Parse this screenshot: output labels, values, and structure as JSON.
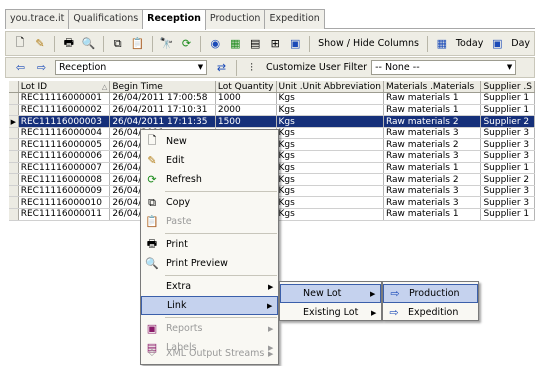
{
  "tabs": [
    {
      "label": "you.trace.it",
      "active": false
    },
    {
      "label": "Qualifications",
      "active": false
    },
    {
      "label": "Reception",
      "active": true
    },
    {
      "label": "Production",
      "active": false
    },
    {
      "label": "Expedition",
      "active": false
    }
  ],
  "toolbar1": {
    "show_hide_columns": "Show / Hide Columns",
    "today": "Today",
    "day": "Day"
  },
  "toolbar2": {
    "view_select": "Reception",
    "customize_filter": "Customize User Filter",
    "filter_select": "-- None --"
  },
  "grid": {
    "columns": [
      "Lot ID",
      "Begin Time",
      "Lot Quantity",
      "Unit .Unit Abbreviation",
      "Materials .Materials",
      "Supplier .S"
    ],
    "rows": [
      [
        "REC11116000001",
        "26/04/2011 17:00:58",
        "1000",
        "Kgs",
        "Raw materials 1",
        "Supplier 1"
      ],
      [
        "REC11116000002",
        "26/04/2011 17:10:31",
        "2000",
        "Kgs",
        "Raw materials 1",
        "Supplier 1"
      ],
      [
        "REC11116000003",
        "26/04/2011 17:11:35",
        "1500",
        "Kgs",
        "Raw materials 2",
        "Supplier 2"
      ],
      [
        "REC11116000004",
        "26/04/2011",
        "",
        "Kgs",
        "Raw materials 3",
        "Supplier 3"
      ],
      [
        "REC11116000005",
        "26/04/2011",
        "",
        "Kgs",
        "Raw materials 2",
        "Supplier 3"
      ],
      [
        "REC11116000006",
        "26/04/2011",
        "",
        "Kgs",
        "Raw materials 3",
        "Supplier 3"
      ],
      [
        "REC11116000007",
        "26/04/2011",
        "",
        "Kgs",
        "Raw materials 1",
        "Supplier 1"
      ],
      [
        "REC11116000008",
        "26/04/2011",
        "",
        "Kgs",
        "Raw materials 2",
        "Supplier 2"
      ],
      [
        "REC11116000009",
        "26/04/2011",
        "",
        "Kgs",
        "Raw materials 3",
        "Supplier 3"
      ],
      [
        "REC11116000010",
        "26/04/2011",
        "",
        "Kgs",
        "Raw materials 3",
        "Supplier 3"
      ],
      [
        "REC11116000011",
        "26/04/2011",
        "",
        "Kgs",
        "Raw materials 1",
        "Supplier 1"
      ]
    ],
    "selected_row": 2
  },
  "context_menu": {
    "new": "New",
    "edit": "Edit",
    "refresh": "Refresh",
    "copy": "Copy",
    "paste": "Paste",
    "print": "Print",
    "print_preview": "Print Preview",
    "extra": "Extra",
    "link": "Link",
    "reports": "Reports",
    "labels": "Labels",
    "xml_output_streams": "XML Output Streams"
  },
  "submenu_link": {
    "new_lot": "New Lot",
    "existing_lot": "Existing Lot"
  },
  "submenu_new_lot": {
    "production": "Production",
    "expedition": "Expedition"
  },
  "colors": {
    "selection": "#16307a",
    "highlight": "#c5d2ee",
    "toolbar": "#eeede5"
  }
}
